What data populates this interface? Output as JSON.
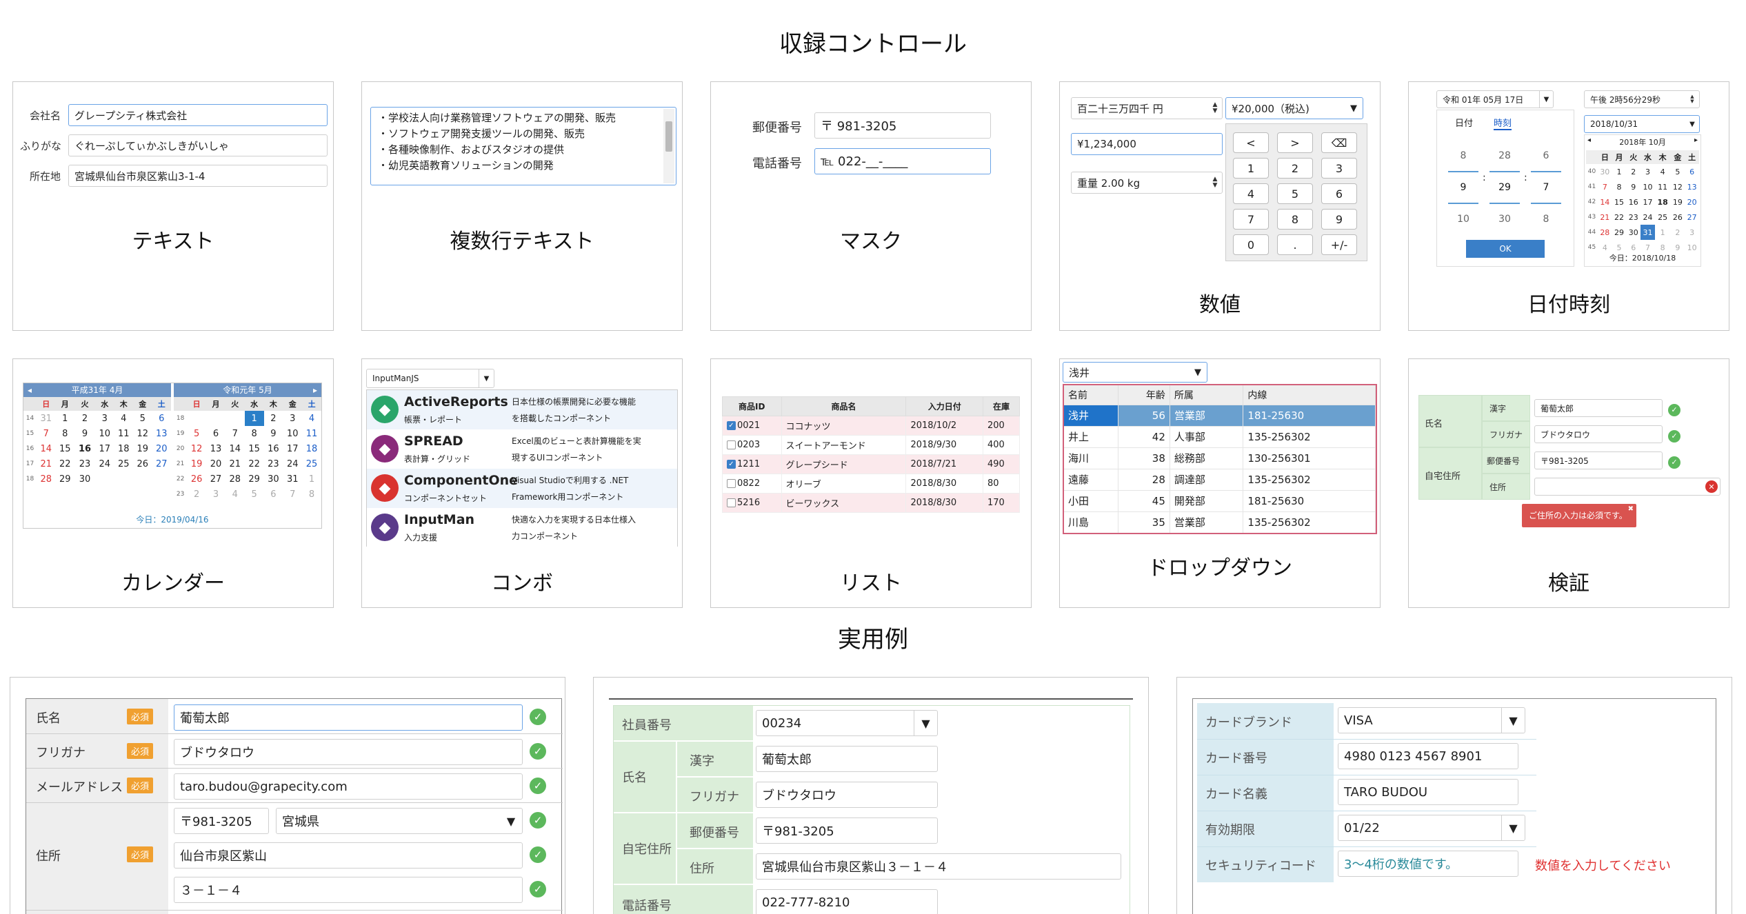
{
  "titles": {
    "controls": "収録コントロール",
    "examples": "実用例"
  },
  "captions": {
    "text": "テキスト",
    "multiline": "複数行テキスト",
    "mask": "マスク",
    "number": "数値",
    "datetime": "日付時刻",
    "calendar": "カレンダー",
    "combo": "コンボ",
    "list": "リスト",
    "dropdown": "ドロップダウン",
    "validation": "検証"
  },
  "text_card": {
    "rows": [
      {
        "label": "会社名",
        "value": "グレープシティ株式会社"
      },
      {
        "label": "ふりがな",
        "value": "ぐれーぷしてぃかぶしきがいしゃ"
      },
      {
        "label": "所在地",
        "value": "宮城県仙台市泉区紫山3-1-4"
      }
    ]
  },
  "multiline_card": {
    "lines": [
      "・学校法人向け業務管理ソフトウェアの開発、販売",
      "・ソフトウェア開発支援ツールの開発、販売",
      "・各種映像制作、およびスタジオの提供",
      "・幼児英語教育ソリューションの開発"
    ]
  },
  "mask_card": {
    "postal_label": "郵便番号",
    "postal_value": "〒 981-3205",
    "phone_label": "電話番号",
    "phone_value": "℡ 022-__-____"
  },
  "number_card": {
    "kanji_value": "百二十三万四千 円",
    "currency_value": "¥1,234,000",
    "weight_value": "重量 2.00 kg",
    "calc_value": "¥20,000（税込)",
    "keys": [
      "<",
      ">",
      "⌫",
      "1",
      "2",
      "3",
      "4",
      "5",
      "6",
      "7",
      "8",
      "9",
      "0",
      ".",
      "+/-"
    ]
  },
  "datetime_card": {
    "date_value": "令和 01年 05月 17日",
    "tab_date": "日付",
    "tab_time": "時刻",
    "picker_cols": [
      [
        "8",
        "9",
        "10"
      ],
      [
        "28",
        "29",
        "30"
      ],
      [
        "6",
        "7",
        "8"
      ]
    ],
    "ok": "OK",
    "time_value": "午後 2時56分29秒",
    "date2_value": "2018/10/31",
    "cal_header": "2018年 10月",
    "weekdays": [
      "日",
      "月",
      "火",
      "水",
      "木",
      "金",
      "土"
    ],
    "week_nums": [
      "40",
      "41",
      "42",
      "43",
      "44",
      "45"
    ],
    "cal_rows": [
      [
        "30",
        "1",
        "2",
        "3",
        "4",
        "5",
        "6"
      ],
      [
        "7",
        "8",
        "9",
        "10",
        "11",
        "12",
        "13"
      ],
      [
        "14",
        "15",
        "16",
        "17",
        "18",
        "19",
        "20"
      ],
      [
        "21",
        "22",
        "23",
        "24",
        "25",
        "26",
        "27"
      ],
      [
        "28",
        "29",
        "30",
        "31",
        "1",
        "2",
        "3"
      ],
      [
        "4",
        "5",
        "6",
        "7",
        "8",
        "9",
        "10"
      ]
    ],
    "today": "今日：2018/10/18"
  },
  "calendar_card": {
    "left_header": "平成31年 4月",
    "right_header": "令和元年 5月",
    "weekdays": [
      "日",
      "月",
      "火",
      "水",
      "木",
      "金",
      "土"
    ],
    "left_weeks": [
      "14",
      "15",
      "16",
      "17",
      "18"
    ],
    "left_rows": [
      [
        "31",
        "1",
        "2",
        "3",
        "4",
        "5",
        "6"
      ],
      [
        "7",
        "8",
        "9",
        "10",
        "11",
        "12",
        "13"
      ],
      [
        "14",
        "15",
        "16",
        "17",
        "18",
        "19",
        "20"
      ],
      [
        "21",
        "22",
        "23",
        "24",
        "25",
        "26",
        "27"
      ],
      [
        "28",
        "29",
        "30",
        "",
        "",
        "",
        ""
      ]
    ],
    "right_weeks": [
      "18",
      "19",
      "20",
      "21",
      "22",
      "23"
    ],
    "right_rows": [
      [
        "",
        "",
        "",
        "1",
        "2",
        "3",
        "4"
      ],
      [
        "5",
        "6",
        "7",
        "8",
        "9",
        "10",
        "11"
      ],
      [
        "12",
        "13",
        "14",
        "15",
        "16",
        "17",
        "18"
      ],
      [
        "19",
        "20",
        "21",
        "22",
        "23",
        "24",
        "25"
      ],
      [
        "26",
        "27",
        "28",
        "29",
        "30",
        "31",
        "1"
      ],
      [
        "2",
        "3",
        "4",
        "5",
        "6",
        "7",
        "8"
      ]
    ],
    "today": "今日：2019/04/16"
  },
  "combo_card": {
    "value": "InputManJS",
    "items": [
      {
        "name": "ActiveReports",
        "sub": "帳票・レポート",
        "desc1": "日本仕様の帳票開発に必要な機能",
        "desc2": "を搭載したコンポーネント",
        "color": "#2aa56a"
      },
      {
        "name": "SPREAD",
        "sub": "表計算・グリッド",
        "desc1": "Excel風のビューと表計算機能を実",
        "desc2": "現するUIコンポーネント",
        "color": "#8a2a7a"
      },
      {
        "name": "ComponentOne",
        "sub": "コンポーネントセット",
        "desc1": "Visual Studioで利用する .NET",
        "desc2": "Framework用コンポーネント",
        "color": "#d9332f"
      },
      {
        "name": "InputMan",
        "sub": "入力支援",
        "desc1": "快適な入力を実現する日本仕様入",
        "desc2": "力コンポーネント",
        "color": "#5a3a8a"
      }
    ]
  },
  "list_card": {
    "headers": [
      "商品ID",
      "商品名",
      "入力日付",
      "在庫"
    ],
    "rows": [
      {
        "id": "0021",
        "name": "ココナッツ",
        "date": "2018/10/2",
        "stock": "200",
        "checked": true
      },
      {
        "id": "0203",
        "name": "スイートアーモンド",
        "date": "2018/9/30",
        "stock": "400",
        "checked": false
      },
      {
        "id": "1211",
        "name": "グレープシード",
        "date": "2018/7/21",
        "stock": "490",
        "checked": true
      },
      {
        "id": "0822",
        "name": "オリーブ",
        "date": "2018/8/30",
        "stock": "80",
        "checked": false
      },
      {
        "id": "5216",
        "name": "ビーワックス",
        "date": "2018/8/30",
        "stock": "170",
        "checked": false
      }
    ]
  },
  "dropdown_card": {
    "value": "浅井",
    "headers": [
      "名前",
      "年齢",
      "所属",
      "内線"
    ],
    "rows": [
      [
        "浅井",
        "56",
        "営業部",
        "181-25630"
      ],
      [
        "井上",
        "42",
        "人事部",
        "135-256302"
      ],
      [
        "海川",
        "38",
        "総務部",
        "130-256301"
      ],
      [
        "遠藤",
        "28",
        "調達部",
        "135-256302"
      ],
      [
        "小田",
        "45",
        "開発部",
        "181-25630"
      ],
      [
        "川島",
        "35",
        "営業部",
        "135-256302"
      ]
    ]
  },
  "validation_card": {
    "name_group": "氏名",
    "kanji_label": "漢字",
    "kanji_value": "葡萄太郎",
    "kana_label": "フリガナ",
    "kana_value": "ブドウタロウ",
    "addr_group": "自宅住所",
    "postal_label": "郵便番号",
    "postal_value": "〒981-3205",
    "addr_label": "住所",
    "addr_value": "",
    "error": "ご住所の入力は必須です。"
  },
  "example1": {
    "required": "必須",
    "rows": [
      {
        "label": "氏名",
        "value": "葡萄太郎"
      },
      {
        "label": "フリガナ",
        "value": "ブドウタロウ"
      },
      {
        "label": "メールアドレス",
        "value": "taro.budou@grapecity.com"
      }
    ],
    "addr_label": "住所",
    "postal": "〒981-3205",
    "pref": "宮城県",
    "city": "仙台市泉区紫山",
    "street": "３－１－４"
  },
  "example2": {
    "emp_label": "社員番号",
    "emp_value": "00234",
    "name_group": "氏名",
    "kanji_label": "漢字",
    "kanji_value": "葡萄太郎",
    "kana_label": "フリガナ",
    "kana_value": "ブドウタロウ",
    "addr_group": "自宅住所",
    "postal_label": "郵便番号",
    "postal_value": "〒981-3205",
    "addr_label": "住所",
    "addr_value": "宮城県仙台市泉区紫山３－１－４",
    "phone_label": "電話番号",
    "phone_value": "022-777-8210"
  },
  "example3": {
    "rows": [
      {
        "label": "カードブランド",
        "value": "VISA",
        "dd": true
      },
      {
        "label": "カード番号",
        "value": "4980 0123 4567 8901",
        "dd": false
      },
      {
        "label": "カード名義",
        "value": "TARO BUDOU",
        "dd": false
      },
      {
        "label": "有効期限",
        "value": "01/22",
        "dd": true
      },
      {
        "label": "セキュリティコード",
        "value": "3〜4桁の数値です。",
        "dd": false
      }
    ],
    "error": "数値を入力してください"
  }
}
